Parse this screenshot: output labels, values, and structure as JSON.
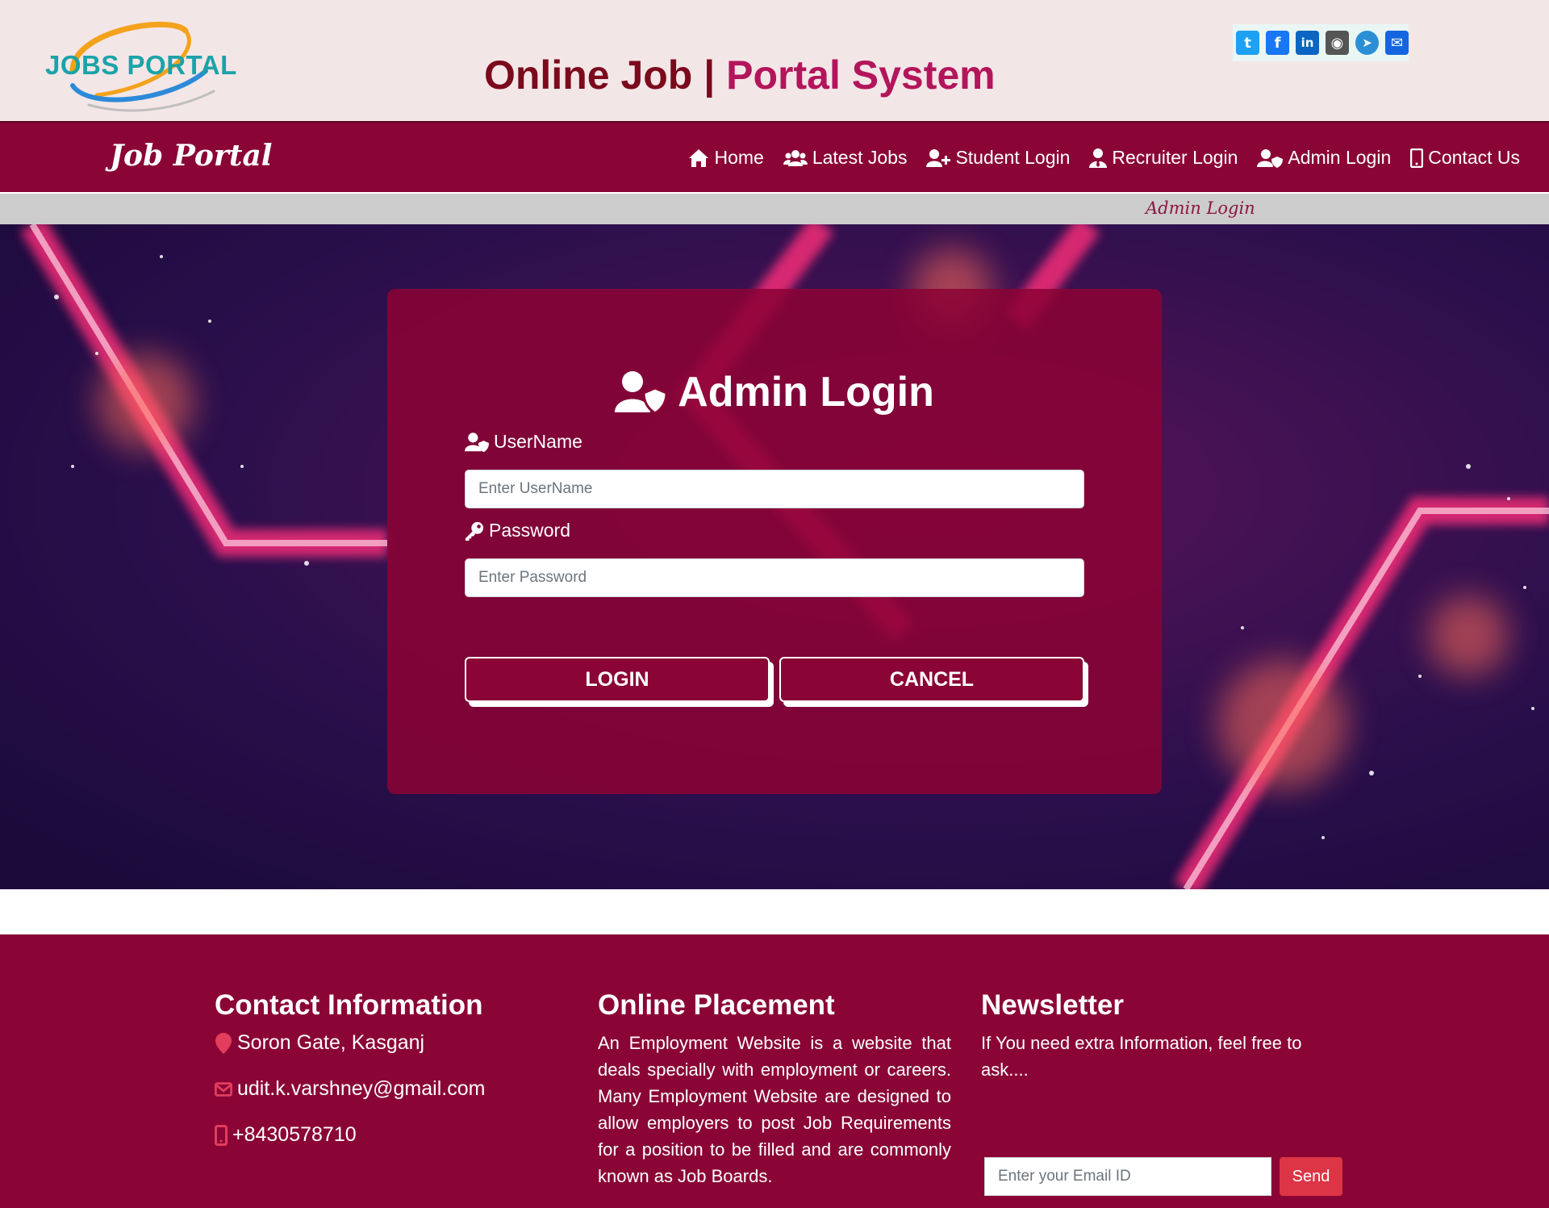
{
  "header": {
    "logo_text": "JOBS PORTAL",
    "title_part1": "Online Job |",
    "title_part2": "Portal System",
    "social": [
      {
        "name": "twitter-icon",
        "glyph": "t",
        "color": "#1da1f2"
      },
      {
        "name": "facebook-icon",
        "glyph": "f",
        "color": "#1877f2"
      },
      {
        "name": "linkedin-icon",
        "glyph": "in",
        "color": "#0a66c2"
      },
      {
        "name": "github-icon",
        "glyph": "◉",
        "color": "#555555"
      },
      {
        "name": "telegram-icon",
        "glyph": "➤",
        "color": "#2a8fd6"
      },
      {
        "name": "email-icon",
        "glyph": "✉",
        "color": "#1565e0"
      }
    ]
  },
  "navbar": {
    "brand": "Job Portal",
    "items": [
      {
        "label": "Home",
        "icon": "home-icon"
      },
      {
        "label": "Latest Jobs",
        "icon": "users-icon"
      },
      {
        "label": "Student Login",
        "icon": "user-plus-icon"
      },
      {
        "label": "Recruiter Login",
        "icon": "user-tie-icon"
      },
      {
        "label": "Admin Login",
        "icon": "user-shield-icon"
      },
      {
        "label": "Contact Us",
        "icon": "mobile-icon"
      }
    ]
  },
  "breadcrumb": "Admin Login",
  "login": {
    "title": "Admin Login",
    "username_label": "UserName",
    "username_placeholder": "Enter UserName",
    "password_label": "Password",
    "password_placeholder": "Enter Password",
    "login_button": "LOGIN",
    "cancel_button": "CANCEL"
  },
  "footer": {
    "contact": {
      "heading": "Contact Information",
      "address": "Soron Gate, Kasganj",
      "email": "udit.k.varshney@gmail.com",
      "phone": "+8430578710"
    },
    "placement": {
      "heading": "Online Placement",
      "text": "An Employment Website is a website that deals specially with employment or careers. Many Employment Website are designed to allow employers to post Job Requirements for a position to be filled and are commonly known as Job Boards."
    },
    "newsletter": {
      "heading": "Newsletter",
      "text": "If You need extra Information, feel free to ask....",
      "email_placeholder": "Enter your Email ID",
      "send_button": "Send"
    }
  },
  "colors": {
    "primary": "#8a0535",
    "header_bg": "#f3e6e7",
    "title_dark": "#7b0a1c",
    "title_accent": "#b3155b",
    "send_button": "#dc3545"
  }
}
